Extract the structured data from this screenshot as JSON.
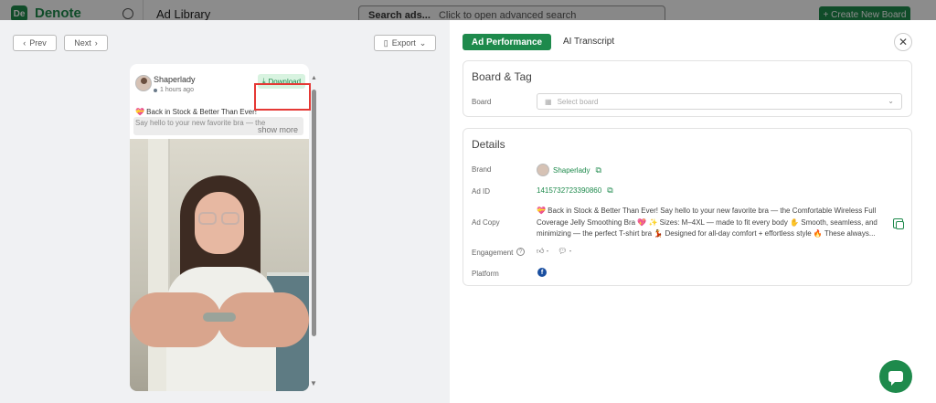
{
  "background": {
    "logo_text": "De",
    "brand": "Denote",
    "title": "Ad Library",
    "search_bold": "Search ads...",
    "search_hint": "Click to open advanced search",
    "cta_label": "+ Create New Board"
  },
  "nav": {
    "prev_label": "Prev",
    "next_label": "Next",
    "export_label": "Export"
  },
  "ad_card": {
    "brand_name": "Shaperlady",
    "posted_time": "1 hours ago",
    "download_label": "Download",
    "headline": "💝 Back in Stock & Better Than Ever!",
    "subtext": "Say hello to your new favorite bra — the",
    "show_more": "show more"
  },
  "tabs": {
    "active": "Ad Performance",
    "other": "AI Transcript"
  },
  "board_tag": {
    "title": "Board & Tag",
    "board_label": "Board",
    "board_placeholder": "Select board"
  },
  "details": {
    "title": "Details",
    "brand_label": "Brand",
    "brand_value": "Shaperlady",
    "ad_id_label": "Ad ID",
    "ad_id_value": "1415732723390860",
    "ad_copy_label": "Ad Copy",
    "ad_copy_value": "💝 Back in Stock & Better Than Ever! Say hello to your new favorite bra — the Comfortable Wireless Full Coverage Jelly Smoothing Bra 💖 ✨ Sizes: M–4XL — made to fit every body ✋ Smooth, seamless, and minimizing — the perfect T-shirt bra 💃 Designed for all-day comfort + effortless style 🔥 These always...",
    "engagement_label": "Engagement",
    "likes": "-",
    "comments": "-",
    "platform_label": "Platform",
    "platform_icon": "f"
  },
  "colors": {
    "accent": "#1e8a4c",
    "highlight": "#e53935"
  }
}
